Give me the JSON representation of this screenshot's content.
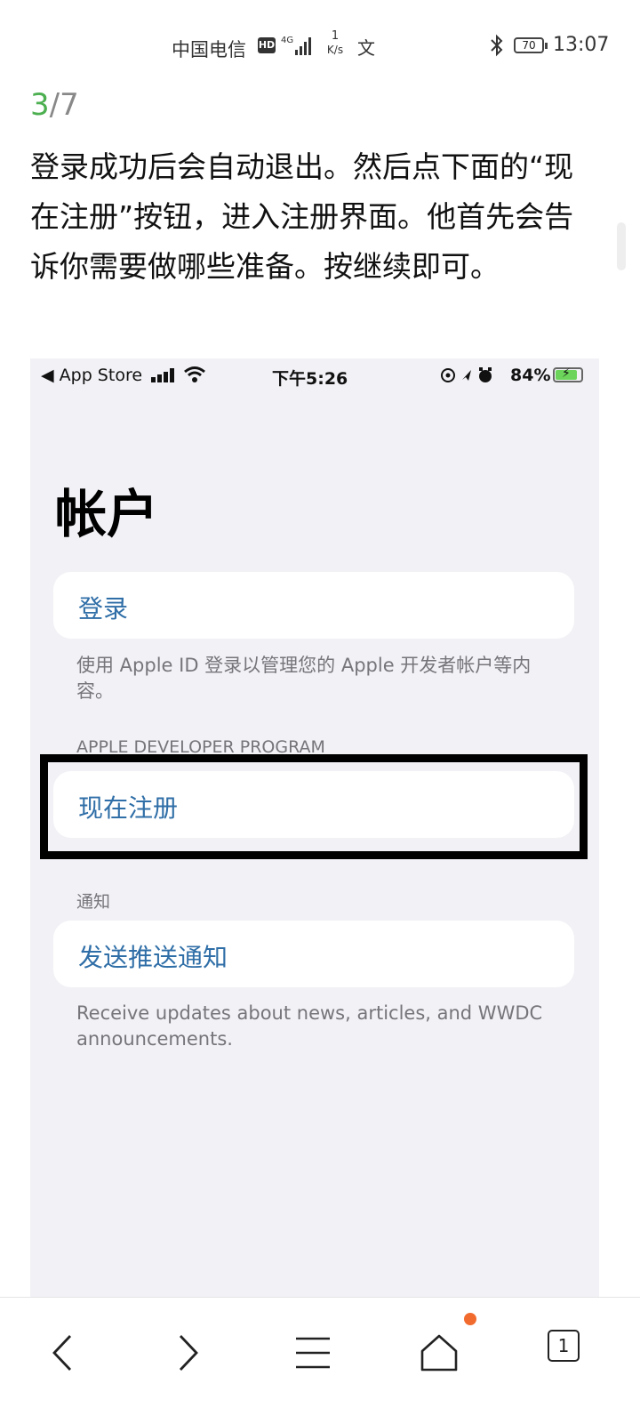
{
  "status_bar": {
    "carrier": "中国电信",
    "hd_badge": "HD",
    "net_type": "4G",
    "speed_value": "1",
    "speed_unit": "K/s",
    "battery": "70",
    "time": "13:07"
  },
  "article": {
    "page_current": "3",
    "page_total": "/7",
    "description": "登录成功后会自动退出。然后点下面的“现在注册”按钮，进入注册界面。他首先会告诉你需要做哪些准备。按继续即可。"
  },
  "ios_screenshot": {
    "status": {
      "back_label": "◀ App Store",
      "time": "下午5:26",
      "battery_pct": "84%",
      "battery_level": 0.84
    },
    "title": "帐户",
    "sign_in": "登录",
    "sign_in_footer": "使用 Apple ID 登录以管理您的 Apple 开发者帐户等内容。",
    "program_header": "APPLE DEVELOPER PROGRAM",
    "enroll": "现在注册",
    "notify_header": "通知",
    "push": "发送推送通知",
    "push_footer": "Receive updates about news, articles, and WWDC announcements."
  },
  "toolbar": {
    "back_icon": "chevron-left-icon",
    "forward_icon": "chevron-right-icon",
    "menu_icon": "menu-icon",
    "home_icon": "home-icon",
    "tabs_count": "1",
    "notification_color": "#f26b2e"
  }
}
